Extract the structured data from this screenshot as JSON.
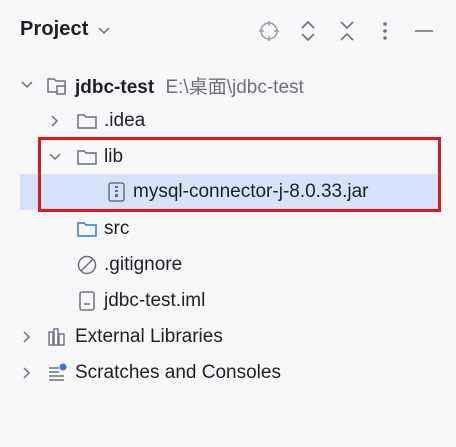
{
  "panel": {
    "title": "Project"
  },
  "tree": {
    "root": {
      "name": "jdbc-test",
      "path": "E:\\桌面\\jdbc-test"
    },
    "idea": {
      "name": ".idea"
    },
    "lib": {
      "name": "lib"
    },
    "jar": {
      "name": "mysql-connector-j-8.0.33.jar"
    },
    "src": {
      "name": "src"
    },
    "gitignore": {
      "name": ".gitignore"
    },
    "iml": {
      "name": "jdbc-test.iml"
    },
    "external": {
      "name": "External Libraries"
    },
    "scratches": {
      "name": "Scratches and Consoles"
    }
  },
  "colors": {
    "selection": "#d6e4fb",
    "highlight": "#e0181a",
    "icon": "#6c707e",
    "folder_blue": "#3574f0"
  }
}
